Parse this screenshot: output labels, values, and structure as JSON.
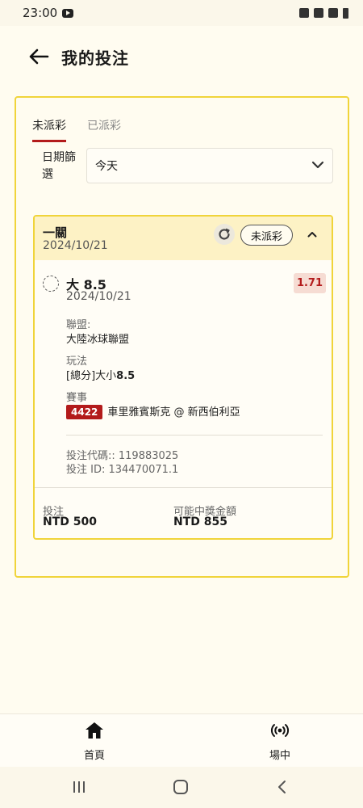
{
  "status_bar": {
    "time": "23:00"
  },
  "header": {
    "title": "我的投注"
  },
  "tabs": [
    {
      "label": "未派彩",
      "active": true
    },
    {
      "label": "已派彩",
      "active": false
    }
  ],
  "filter": {
    "label": "日期篩選",
    "selected": "今天"
  },
  "bet": {
    "title": "一關",
    "date": "2024/10/21",
    "status": "未派彩",
    "selection": {
      "name": "大 8.5",
      "date": "2024/10/21",
      "odds": "1.71",
      "league_label": "聯盟:",
      "league": "大陸冰球聯盟",
      "market_label": "玩法",
      "market_prefix": "[總分]大小",
      "market_value": "8.5",
      "event_label": "賽事",
      "event_id": "4422",
      "event_name": "車里雅賓斯克 @ 新西伯利亞"
    },
    "bet_code": "投注代碼:: 119883025",
    "bet_id": "投注 ID: 134470071.1",
    "stake_label": "投注",
    "stake": "NTD 500",
    "payout_label": "可能中獎金額",
    "payout": "NTD 855"
  },
  "bottom_nav": [
    {
      "label": "首頁",
      "icon": "home-icon"
    },
    {
      "label": "場中",
      "icon": "live-signal-icon"
    }
  ],
  "colors": {
    "accent": "#f0d43a",
    "red": "#b31b1b",
    "background": "#fffcf0"
  }
}
